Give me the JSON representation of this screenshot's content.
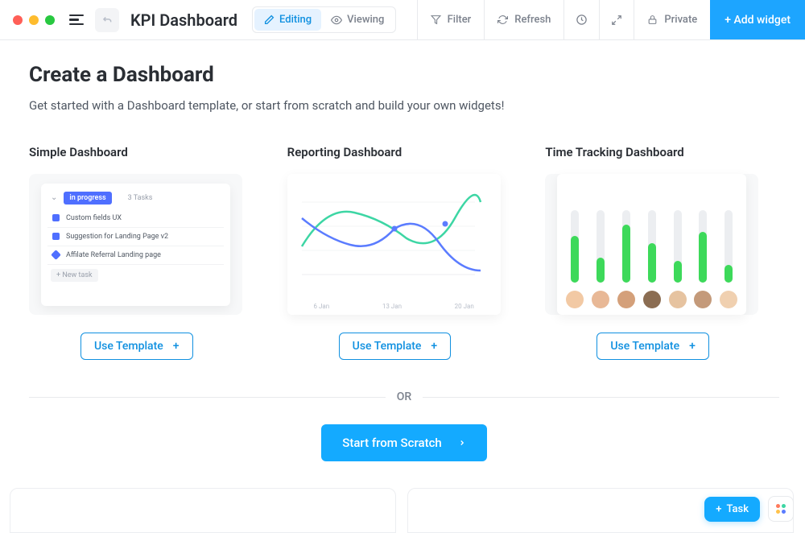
{
  "header": {
    "title": "KPI Dashboard",
    "modes": {
      "editing": "Editing",
      "viewing": "Viewing"
    },
    "toolbar": {
      "filter": "Filter",
      "refresh": "Refresh",
      "private": "Private",
      "add_widget": "+ Add widget"
    }
  },
  "main": {
    "heading": "Create a Dashboard",
    "subheading": "Get started with a Dashboard template, or start from scratch and build your own widgets!",
    "templates": [
      {
        "title": "Simple Dashboard",
        "cta": "Use Template"
      },
      {
        "title": "Reporting Dashboard",
        "cta": "Use Template"
      },
      {
        "title": "Time Tracking Dashboard",
        "cta": "Use Template"
      }
    ],
    "preview1": {
      "status_label": "in progress",
      "count_label": "3 Tasks",
      "rows": [
        "Custom fields UX",
        "Suggestion for Landing Page v2",
        "Affilate Referral Landing page"
      ],
      "new_task": "+ New task"
    },
    "preview2": {
      "dates": [
        "6 Jan",
        "13 Jan",
        "20 Jan"
      ]
    },
    "preview3": {
      "bar_heights_pct": [
        65,
        35,
        80,
        55,
        30,
        70,
        25
      ]
    },
    "or_label": "OR",
    "scratch_label": "Start from Scratch"
  },
  "footer": {
    "task_button": "Task"
  },
  "chart_data": {
    "type": "line",
    "title": "",
    "x": [
      "6 Jan",
      "13 Jan",
      "20 Jan"
    ],
    "series": [
      {
        "name": "green",
        "values": [
          35,
          65,
          40,
          72
        ],
        "color": "#3dd6a4"
      },
      {
        "name": "blue",
        "values": [
          60,
          35,
          50,
          20
        ],
        "color": "#5b7cff"
      }
    ],
    "xlabel": "",
    "ylabel": ""
  }
}
